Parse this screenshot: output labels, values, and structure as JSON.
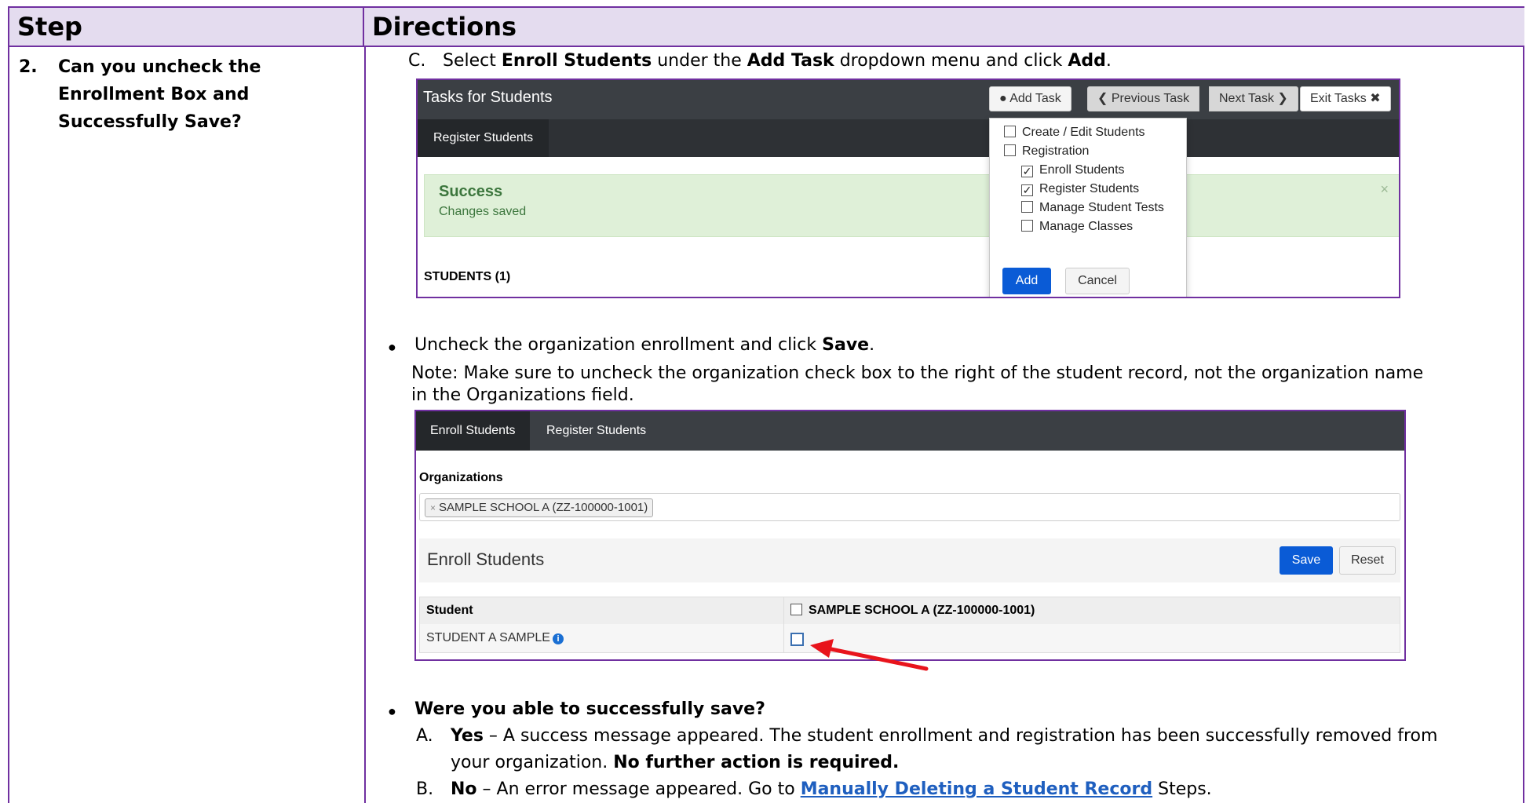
{
  "table": {
    "header_step": "Step",
    "header_directions": "Directions",
    "step_number": "2.",
    "step_line1": "Can you uncheck the",
    "step_line2": "Enrollment Box and",
    "step_line3": "Successfully Save?"
  },
  "directions": {
    "c_label": "C.",
    "c_pre": "Select ",
    "c_b1": "Enroll Students",
    "c_mid": " under the ",
    "c_b2": "Add Task",
    "c_mid2": " dropdown menu and click ",
    "c_b3": "Add",
    "c_end": ".",
    "uncheck_pre": "Uncheck the organization enrollment and click ",
    "uncheck_b": "Save",
    "uncheck_end": ".",
    "note_line1": "Note: Make sure to uncheck the organization check box to the right of the student record, not the organization name",
    "note_line2": "in the Organizations field.",
    "question": "Were you able to successfully save?",
    "a_label": "A.",
    "a_b": "Yes",
    "a_text": " – A success message appeared. The student enrollment and registration has been successfully removed from",
    "a_line2_pre": "your organization. ",
    "a_line2_b": "No further action is required.",
    "b_label": "B.",
    "b_b": "No",
    "b_text": " – An error message appeared. Go to ",
    "b_link": "Manually Deleting a Student Record",
    "b_end": " Steps."
  },
  "shot1": {
    "title": "Tasks for Students",
    "btn_add_task": "Add Task",
    "btn_prev": "Previous Task",
    "btn_next": "Next Task",
    "btn_exit": "Exit Tasks",
    "tab": "Register Students",
    "success_title": "Success",
    "success_msg": "Changes saved",
    "close": "×",
    "students": "STUDENTS (1)",
    "menu": [
      {
        "label": "Create / Edit Students",
        "checked": false
      },
      {
        "label": "Registration",
        "checked": false
      },
      {
        "label": "Enroll Students",
        "checked": true
      },
      {
        "label": "Register Students",
        "checked": true
      },
      {
        "label": "Manage Student Tests",
        "checked": false
      },
      {
        "label": "Manage Classes",
        "checked": false
      }
    ],
    "add": "Add",
    "cancel": "Cancel"
  },
  "shot2": {
    "tab1": "Enroll Students",
    "tab2": "Register Students",
    "org_label": "Organizations",
    "org_chip": "SAMPLE SCHOOL A (ZZ-100000-1001)",
    "panel_title": "Enroll Students",
    "save": "Save",
    "reset": "Reset",
    "col_student": "Student",
    "col_school": "SAMPLE SCHOOL A (ZZ-100000-1001)",
    "student_name": "STUDENT A SAMPLE"
  },
  "colors": {
    "border": "#7030a0",
    "header_bg": "#e4dcef",
    "primary_btn": "#0a5bd6",
    "arrow": "#e8141c",
    "link": "#1f5fbf"
  }
}
